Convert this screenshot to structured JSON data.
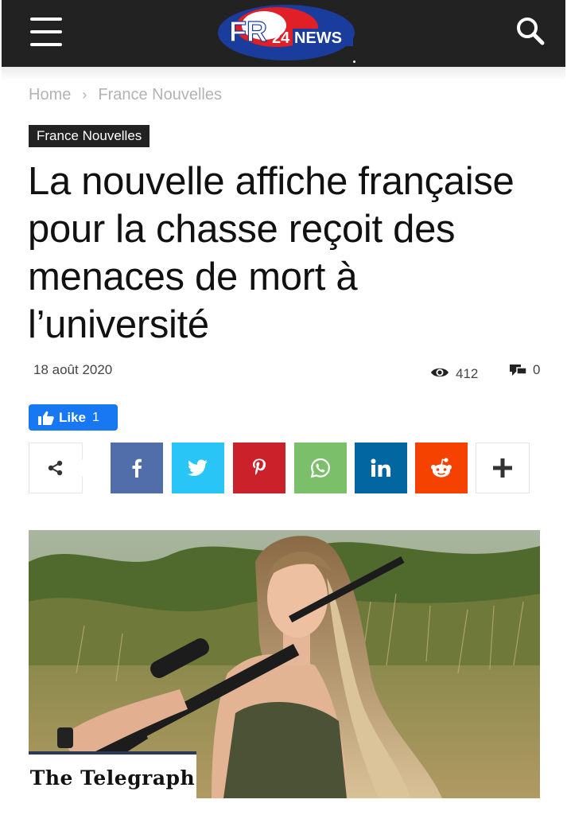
{
  "header": {
    "logo_text_fr": "FR",
    "logo_text_24": "24",
    "logo_text_news": "NEWS",
    "menu_icon": "hamburger-menu-icon",
    "search_icon": "search-icon"
  },
  "breadcrumb": {
    "home": "Home",
    "separator": "›",
    "category": "France Nouvelles"
  },
  "article": {
    "category_tag": "France Nouvelles",
    "title": "La nouvelle affiche française pour la chasse reçoit des menaces de mort à l’université",
    "date": "18 août 2020",
    "views": "412",
    "comments": "0"
  },
  "facebook_like": {
    "label": "Like",
    "count": "1"
  },
  "share": {
    "buttons": [
      {
        "name": "facebook",
        "color": "#516eab"
      },
      {
        "name": "twitter",
        "color": "#29c5f6"
      },
      {
        "name": "pinterest",
        "color": "#ca212a"
      },
      {
        "name": "whatsapp",
        "color": "#7bbf6a"
      },
      {
        "name": "linkedin",
        "color": "#0266a0"
      },
      {
        "name": "reddit",
        "color": "#f54200"
      }
    ],
    "more_icon": "plus-icon"
  },
  "image": {
    "caption_source": "The Telegraph"
  },
  "colors": {
    "topbar": "#222222",
    "like_blue": "#1877f2",
    "logo_red": "#e01f26",
    "logo_blue": "#1a3c9c"
  }
}
